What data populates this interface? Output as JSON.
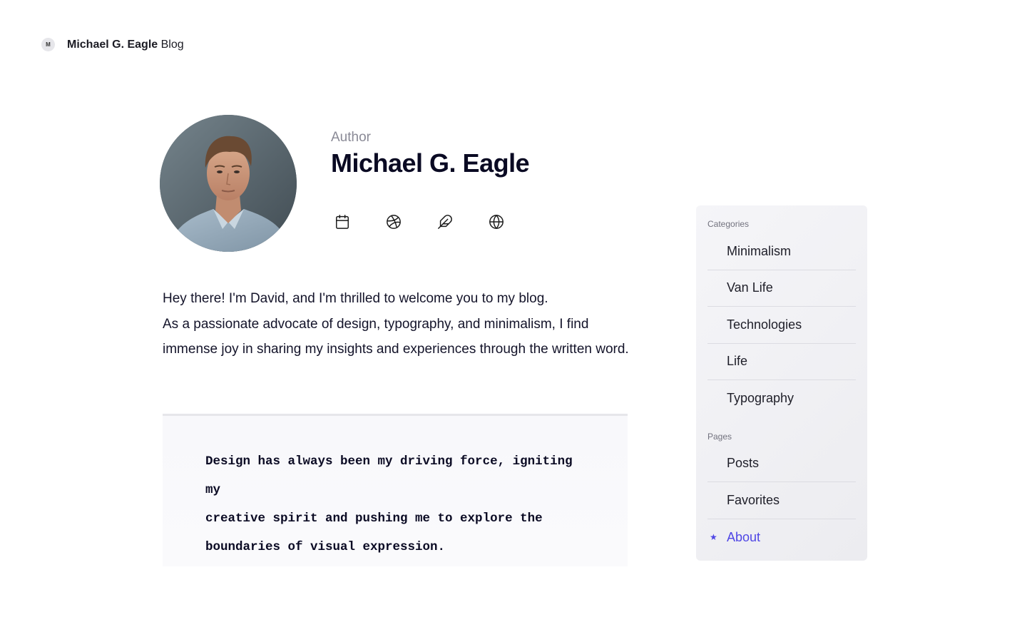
{
  "header": {
    "badge": "M",
    "author_name": "Michael G. Eagle",
    "blog_word": "Blog"
  },
  "author": {
    "label": "Author",
    "name": "Michael G. Eagle",
    "social": [
      {
        "icon": "calendar-icon"
      },
      {
        "icon": "dribbble-icon"
      },
      {
        "icon": "feather-icon"
      },
      {
        "icon": "globe-icon"
      }
    ]
  },
  "bio": {
    "line1": "Hey there! I'm David, and I'm thrilled to welcome you to my blog.",
    "line2": "As a passionate advocate of design, typography, and minimalism, I find immense joy in sharing my insights and experiences through the written word."
  },
  "quote": {
    "text_line1": "Design has always been my driving force, igniting my",
    "text_line2": "creative spirit and pushing me to explore the",
    "text_line3": "boundaries of visual expression."
  },
  "sidebar": {
    "categories_label": "Categories",
    "categories": [
      {
        "label": "Minimalism"
      },
      {
        "label": "Van Life"
      },
      {
        "label": "Technologies"
      },
      {
        "label": "Life"
      },
      {
        "label": "Typography"
      }
    ],
    "pages_label": "Pages",
    "pages": [
      {
        "label": "Posts"
      },
      {
        "label": "Favorites"
      },
      {
        "label": "About",
        "active": true,
        "marker": "★"
      }
    ]
  },
  "colors": {
    "accent": "#4f46e5",
    "text_primary": "#0a0a23",
    "text_muted": "#8a8a96",
    "sidebar_bg": "#f0f0f4"
  }
}
